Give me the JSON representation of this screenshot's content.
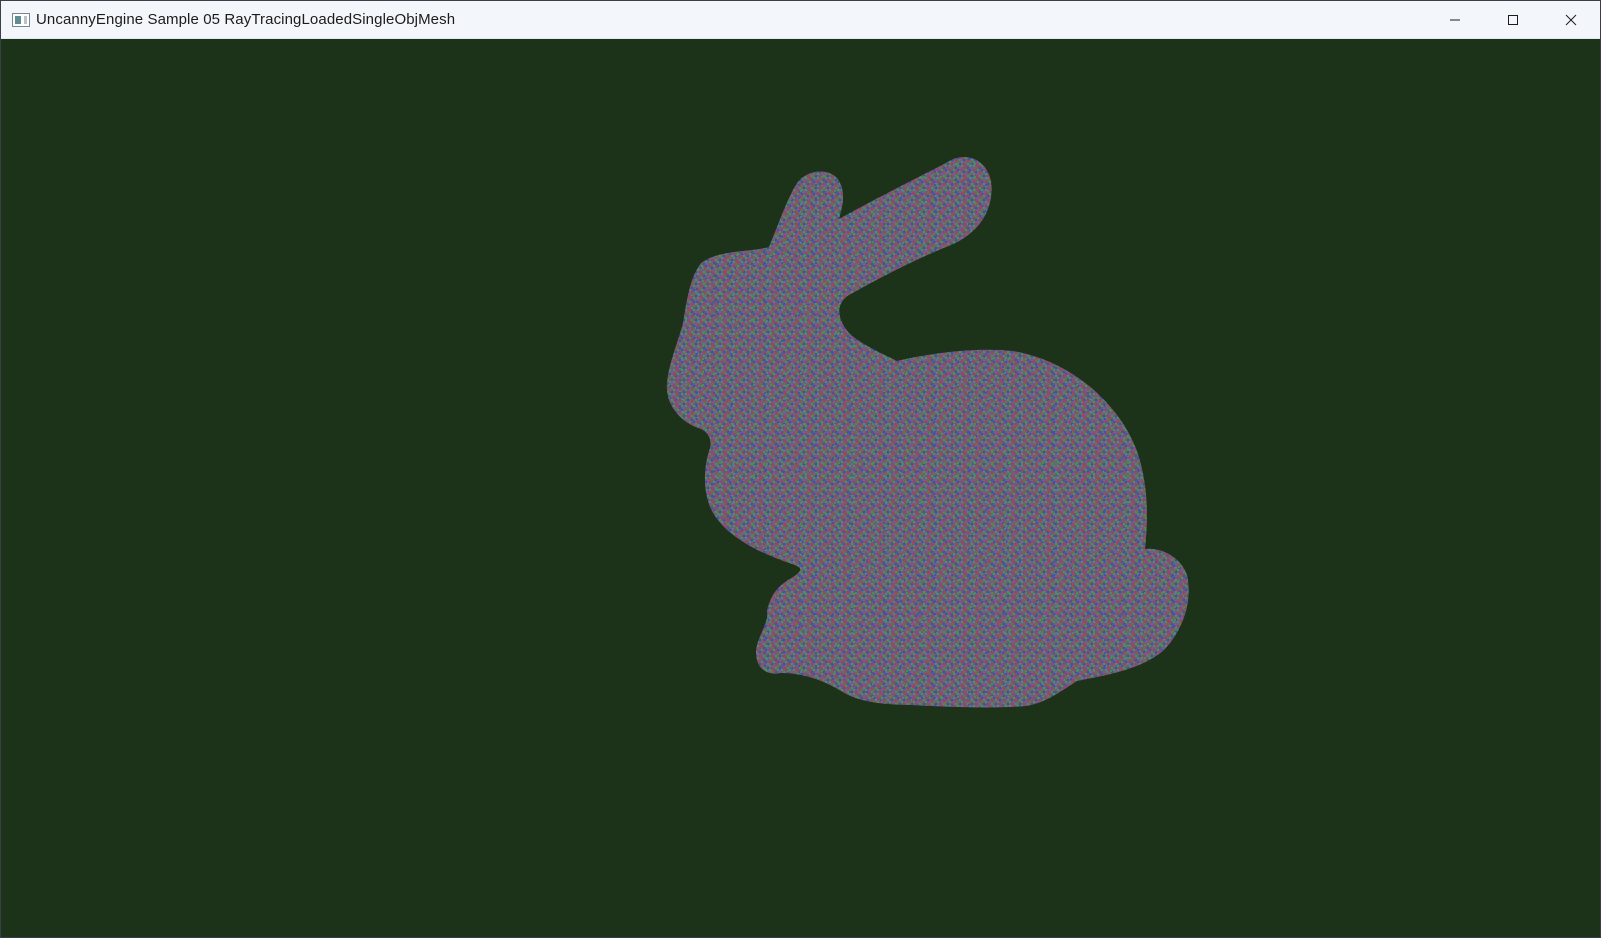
{
  "window": {
    "title": "UncannyEngine Sample 05 RayTracingLoadedSingleObjMesh",
    "icon": "application-window-icon",
    "controls": {
      "minimize_icon": "minimize-icon",
      "maximize_icon": "maximize-icon",
      "close_icon": "close-icon"
    }
  },
  "viewport": {
    "background_color": "#1c3219",
    "object": "stanford-bunny-mesh",
    "object_colors": [
      "#b03a5e",
      "#3d9a4e",
      "#3b4fb8",
      "#7f6a3a",
      "#8a4fa0",
      "#4a8a8c"
    ]
  }
}
